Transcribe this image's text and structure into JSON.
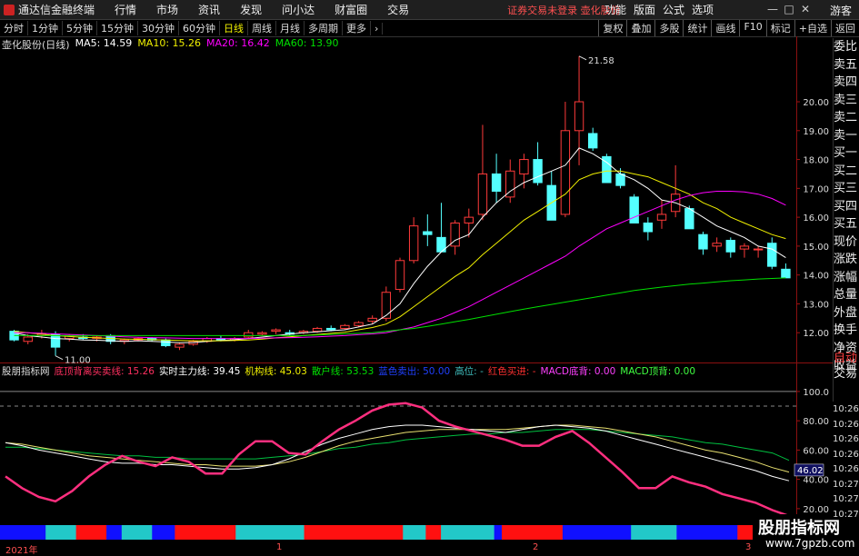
{
  "menubar": {
    "app_title": "通达信金融终端",
    "items": [
      "行情",
      "市场",
      "资讯",
      "发现",
      "问小达",
      "财富圈",
      "交易"
    ],
    "status": "证券交易未登录  壶化股份",
    "right": [
      "功能",
      "版面",
      "公式",
      "选项"
    ],
    "guest": "游客"
  },
  "toolbar": {
    "periods": [
      "分时",
      "1分钟",
      "5分钟",
      "15分钟",
      "30分钟",
      "60分钟",
      "日线",
      "周线",
      "月线",
      "多周期",
      "更多"
    ],
    "active": "日线",
    "right": [
      "复权",
      "叠加",
      "多股",
      "统计",
      "画线",
      "F10",
      "标记",
      "+自选",
      "返回"
    ]
  },
  "main_chart": {
    "stock_label": "壶化股份(日线)",
    "ma": [
      {
        "name": "MA5",
        "value": "MA5: 14.59",
        "color": "#ffffff"
      },
      {
        "name": "MA10",
        "value": "MA10: 15.26",
        "color": "#f0f000"
      },
      {
        "name": "MA20",
        "value": "MA20: 16.42",
        "color": "#ff00ff"
      },
      {
        "name": "MA60",
        "value": "MA60: 13.90",
        "color": "#00e000"
      }
    ],
    "y_ticks": [
      "20.00",
      "19.00",
      "18.00",
      "17.00",
      "16.00",
      "15.00",
      "14.00",
      "13.00",
      "12.00"
    ],
    "high_label": "21.58",
    "low_label": "11.00"
  },
  "indicator": {
    "name": "股朋指标网",
    "items": [
      {
        "text": "底顶背离买卖线: 15.26",
        "color": "#ff3060"
      },
      {
        "text": "实时主力线: 39.45",
        "color": "#ffffff"
      },
      {
        "text": "机构线: 45.03",
        "color": "#f0f000"
      },
      {
        "text": "散户线: 53.53",
        "color": "#00e000"
      },
      {
        "text": "蓝色卖出: 50.00",
        "color": "#2040ff"
      },
      {
        "text": "高位: -",
        "color": "#40c0c0"
      },
      {
        "text": "红色买进: -",
        "color": "#ff3030"
      },
      {
        "text": "MACD底背: 0.00",
        "color": "#ff40ff"
      },
      {
        "text": "MACD顶背: 0.00",
        "color": "#40ff40"
      }
    ],
    "y_ticks": [
      "100.0",
      "80.00",
      "60.00",
      "40.00",
      "20.00"
    ],
    "current_value": "46.02"
  },
  "right_panel": [
    "委比",
    "卖五",
    "卖四",
    "卖三",
    "卖二",
    "卖一",
    "买一",
    "买二",
    "买三",
    "买四",
    "买五",
    "现价",
    "涨跌",
    "涨幅",
    "总量",
    "外盘",
    "换手",
    "净资",
    "收益"
  ],
  "right_panel2": [
    "自动",
    "交易"
  ],
  "times": [
    "10:26",
    "10:26",
    "10:26",
    "10:26",
    "10:26",
    "10:27",
    "10:27",
    "10:27"
  ],
  "x_axis": {
    "labels": [
      "2021年",
      "1",
      "2",
      "3"
    ]
  },
  "watermark": {
    "line1": "股朋指标网",
    "line2": "www.7gpzb.com"
  },
  "chart_data": {
    "type": "candlestick",
    "ylim": [
      11.0,
      21.7
    ],
    "candles": [
      [
        12.05,
        12.1,
        11.7,
        11.75
      ],
      [
        11.7,
        11.95,
        11.6,
        11.85
      ],
      [
        11.9,
        12.1,
        11.8,
        11.95
      ],
      [
        11.95,
        12.05,
        11.2,
        11.5
      ],
      [
        11.8,
        11.95,
        11.7,
        11.9
      ],
      [
        11.85,
        11.95,
        11.75,
        11.8
      ],
      [
        11.8,
        11.9,
        11.7,
        11.85
      ],
      [
        11.9,
        11.95,
        11.6,
        11.7
      ],
      [
        11.7,
        11.8,
        11.6,
        11.75
      ],
      [
        11.75,
        11.85,
        11.7,
        11.8
      ],
      [
        11.8,
        11.85,
        11.7,
        11.75
      ],
      [
        11.75,
        11.8,
        11.5,
        11.55
      ],
      [
        11.5,
        11.65,
        11.4,
        11.6
      ],
      [
        11.6,
        11.75,
        11.55,
        11.7
      ],
      [
        11.7,
        11.85,
        11.65,
        11.8
      ],
      [
        11.8,
        11.9,
        11.7,
        11.75
      ],
      [
        11.75,
        11.85,
        11.7,
        11.8
      ],
      [
        11.85,
        12.1,
        11.8,
        12.0
      ],
      [
        11.95,
        12.05,
        11.9,
        12.0
      ],
      [
        12.05,
        12.15,
        11.95,
        12.1
      ],
      [
        12.0,
        12.1,
        11.9,
        11.95
      ],
      [
        12.0,
        12.1,
        11.95,
        12.05
      ],
      [
        12.05,
        12.2,
        12.0,
        12.15
      ],
      [
        12.15,
        12.25,
        12.05,
        12.1
      ],
      [
        12.15,
        12.3,
        12.1,
        12.25
      ],
      [
        12.25,
        12.4,
        12.2,
        12.35
      ],
      [
        12.4,
        12.6,
        12.3,
        12.5
      ],
      [
        12.5,
        13.6,
        12.4,
        13.4
      ],
      [
        13.5,
        14.6,
        13.4,
        14.5
      ],
      [
        14.5,
        16.0,
        14.4,
        15.7
      ],
      [
        15.5,
        16.1,
        15.0,
        15.4
      ],
      [
        15.3,
        16.5,
        14.9,
        14.8
      ],
      [
        15.0,
        15.9,
        14.7,
        15.8
      ],
      [
        15.8,
        16.3,
        15.3,
        16.0
      ],
      [
        16.1,
        19.2,
        15.9,
        17.5
      ],
      [
        17.5,
        18.2,
        16.5,
        16.9
      ],
      [
        16.7,
        18.0,
        16.5,
        17.6
      ],
      [
        17.5,
        18.2,
        17.0,
        18.0
      ],
      [
        18.0,
        18.6,
        17.1,
        17.2
      ],
      [
        17.1,
        17.6,
        15.9,
        15.9
      ],
      [
        16.1,
        20.0,
        16.0,
        19.0
      ],
      [
        19.0,
        21.58,
        17.8,
        20.0
      ],
      [
        18.9,
        19.1,
        18.3,
        18.4
      ],
      [
        18.1,
        18.2,
        17.3,
        17.2
      ],
      [
        17.5,
        17.7,
        17.0,
        17.1
      ],
      [
        16.7,
        16.8,
        15.8,
        15.8
      ],
      [
        15.8,
        16.0,
        15.2,
        15.5
      ],
      [
        15.9,
        16.6,
        15.6,
        16.1
      ],
      [
        16.2,
        17.8,
        16.0,
        16.8
      ],
      [
        16.3,
        16.4,
        15.6,
        15.6
      ],
      [
        15.4,
        15.5,
        14.7,
        14.9
      ],
      [
        15.0,
        15.3,
        14.8,
        15.1
      ],
      [
        15.2,
        15.3,
        14.6,
        14.8
      ],
      [
        14.9,
        15.1,
        14.6,
        15.0
      ],
      [
        14.9,
        15.0,
        14.6,
        14.9
      ],
      [
        15.1,
        15.3,
        14.2,
        14.3
      ],
      [
        14.2,
        14.4,
        13.9,
        13.9
      ]
    ],
    "ma5": [
      12.0,
      11.9,
      11.85,
      11.8,
      11.78,
      11.75,
      11.74,
      11.72,
      11.7,
      11.72,
      11.7,
      11.68,
      11.65,
      11.66,
      11.7,
      11.73,
      11.76,
      11.8,
      11.85,
      11.9,
      11.95,
      12.0,
      12.03,
      12.07,
      12.1,
      12.2,
      12.3,
      12.6,
      13.0,
      13.7,
      14.3,
      14.8,
      15.2,
      15.4,
      16.0,
      16.5,
      16.9,
      17.2,
      17.4,
      17.6,
      17.8,
      18.4,
      18.2,
      17.9,
      17.5,
      17.3,
      17.0,
      16.6,
      16.5,
      16.3,
      16.0,
      15.7,
      15.5,
      15.3,
      15.0,
      14.9,
      14.6
    ],
    "ma10": [
      12.05,
      12.0,
      11.95,
      11.9,
      11.87,
      11.84,
      11.82,
      11.8,
      11.78,
      11.77,
      11.76,
      11.75,
      11.73,
      11.72,
      11.72,
      11.72,
      11.73,
      11.75,
      11.78,
      11.82,
      11.86,
      11.9,
      11.94,
      11.98,
      12.02,
      12.1,
      12.18,
      12.3,
      12.55,
      12.9,
      13.25,
      13.6,
      13.95,
      14.25,
      14.7,
      15.1,
      15.5,
      15.9,
      16.2,
      16.5,
      16.8,
      17.3,
      17.5,
      17.6,
      17.6,
      17.5,
      17.4,
      17.2,
      17.0,
      16.8,
      16.5,
      16.3,
      16.0,
      15.8,
      15.6,
      15.4,
      15.26
    ],
    "ma20": [
      12.0,
      12.0,
      11.98,
      11.96,
      11.94,
      11.92,
      11.9,
      11.88,
      11.86,
      11.84,
      11.83,
      11.82,
      11.81,
      11.8,
      11.8,
      11.8,
      11.8,
      11.8,
      11.81,
      11.82,
      11.83,
      11.84,
      11.86,
      11.88,
      11.9,
      11.93,
      11.96,
      12.0,
      12.1,
      12.2,
      12.35,
      12.5,
      12.7,
      12.9,
      13.15,
      13.4,
      13.65,
      13.9,
      14.15,
      14.4,
      14.65,
      15.0,
      15.3,
      15.6,
      15.8,
      16.0,
      16.2,
      16.4,
      16.6,
      16.75,
      16.85,
      16.9,
      16.9,
      16.88,
      16.8,
      16.65,
      16.42
    ],
    "ma60": [
      11.9,
      11.9,
      11.9,
      11.9,
      11.9,
      11.9,
      11.9,
      11.9,
      11.9,
      11.9,
      11.9,
      11.9,
      11.9,
      11.9,
      11.9,
      11.9,
      11.9,
      11.9,
      11.9,
      11.9,
      11.9,
      11.9,
      11.92,
      11.94,
      11.96,
      11.98,
      12.0,
      12.05,
      12.1,
      12.15,
      12.22,
      12.3,
      12.38,
      12.46,
      12.55,
      12.64,
      12.73,
      12.82,
      12.9,
      12.98,
      13.06,
      13.14,
      13.22,
      13.3,
      13.38,
      13.46,
      13.52,
      13.58,
      13.63,
      13.68,
      13.72,
      13.76,
      13.8,
      13.83,
      13.86,
      13.88,
      13.9
    ],
    "indicator": {
      "ylim": [
        10,
        108
      ],
      "pink": [
        42,
        34,
        28,
        25,
        32,
        42,
        50,
        56,
        52,
        49,
        55,
        52,
        44,
        44,
        57,
        66,
        66,
        58,
        57,
        66,
        74,
        80,
        87,
        91,
        92,
        89,
        80,
        76,
        73,
        70,
        67,
        63,
        63,
        69,
        73,
        65,
        55,
        45,
        34,
        34,
        42,
        38,
        35,
        30,
        27,
        24,
        19,
        15
      ],
      "white": [
        65,
        63,
        60,
        58,
        56,
        54,
        52,
        51,
        51,
        50,
        50,
        49,
        48,
        47,
        47,
        48,
        50,
        54,
        59,
        64,
        68,
        71,
        74,
        76,
        77,
        77,
        76,
        75,
        74,
        73,
        72,
        74,
        76,
        77,
        76,
        75,
        73,
        70,
        67,
        64,
        61,
        58,
        55,
        52,
        49,
        46,
        42,
        39
      ],
      "yellow": [
        65,
        64,
        62,
        60,
        58,
        56,
        55,
        54,
        53,
        52,
        51,
        50,
        50,
        49,
        49,
        49,
        50,
        52,
        55,
        59,
        63,
        66,
        68,
        70,
        72,
        73,
        74,
        74,
        74,
        74,
        74,
        75,
        76,
        77,
        77,
        76,
        75,
        73,
        71,
        69,
        66,
        63,
        60,
        58,
        55,
        52,
        48,
        45
      ],
      "green": [
        62,
        62,
        61,
        60,
        59,
        58,
        57,
        56,
        56,
        55,
        55,
        54,
        54,
        54,
        54,
        54,
        55,
        56,
        57,
        59,
        61,
        62,
        64,
        65,
        67,
        68,
        69,
        70,
        71,
        71,
        72,
        72,
        73,
        74,
        74,
        74,
        73,
        72,
        71,
        70,
        69,
        67,
        65,
        64,
        62,
        60,
        58,
        53
      ],
      "ref_lines": [
        100,
        90
      ],
      "bar_colors": [
        "blue",
        "blue",
        "blue",
        "blue",
        "blue",
        "blue",
        "cyan",
        "cyan",
        "cyan",
        "cyan",
        "red",
        "red",
        "red",
        "red",
        "blue",
        "blue",
        "cyan",
        "cyan",
        "cyan",
        "cyan",
        "blue",
        "blue",
        "blue",
        "red",
        "red",
        "red",
        "red",
        "red",
        "red",
        "red",
        "red",
        "cyan",
        "cyan",
        "cyan",
        "cyan",
        "cyan",
        "cyan",
        "cyan",
        "cyan",
        "cyan",
        "red",
        "red",
        "red",
        "red",
        "red",
        "red",
        "red",
        "red",
        "red",
        "red",
        "red",
        "red",
        "red",
        "cyan",
        "cyan",
        "cyan",
        "red",
        "red",
        "cyan",
        "cyan",
        "cyan",
        "cyan",
        "cyan",
        "cyan",
        "cyan",
        "blue",
        "red",
        "red",
        "red",
        "red",
        "red",
        "red",
        "red",
        "red",
        "blue",
        "blue",
        "blue",
        "blue",
        "blue",
        "blue",
        "blue",
        "blue",
        "blue",
        "cyan",
        "cyan",
        "cyan",
        "cyan",
        "cyan",
        "cyan",
        "blue",
        "blue",
        "blue",
        "blue",
        "blue",
        "blue",
        "blue",
        "blue",
        "red",
        "red"
      ]
    }
  }
}
